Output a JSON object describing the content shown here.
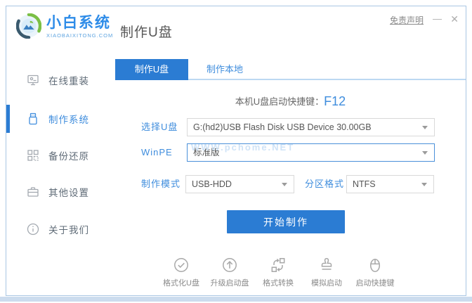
{
  "window": {
    "disclaimer": "免责声明",
    "minimize_glyph": "—",
    "close_glyph": "✕"
  },
  "header": {
    "brand": "小白系统",
    "brand_sub": "XIAOBAIXITONG.COM",
    "page_title": "制作U盘",
    "logo_icon": "swirl-globe-logo"
  },
  "sidebar": {
    "items": [
      {
        "label": "在线重装",
        "icon": "monitor-icon",
        "active": false
      },
      {
        "label": "制作系统",
        "icon": "usb-drive-icon",
        "active": true
      },
      {
        "label": "备份还原",
        "icon": "grid-icon",
        "active": false
      },
      {
        "label": "其他设置",
        "icon": "briefcase-icon",
        "active": false
      },
      {
        "label": "关于我们",
        "icon": "info-icon",
        "active": false
      }
    ]
  },
  "tabs": [
    {
      "label": "制作U盘",
      "active": true
    },
    {
      "label": "制作本地",
      "active": false
    }
  ],
  "main": {
    "hotkey_label": "本机U盘启动快捷键：",
    "hotkey_value": "F12",
    "form": {
      "usb_label": "选择U盘",
      "usb_value": "G:(hd2)USB Flash Disk USB Device 30.00GB",
      "winpe_label": "WinPE",
      "winpe_value": "标准版",
      "winpe_watermark": "WWW.pchome.NET",
      "mode_label": "制作模式",
      "mode_value": "USB-HDD",
      "partition_label": "分区格式",
      "partition_value": "NTFS"
    },
    "start_button": "开始制作"
  },
  "footer_tools": [
    {
      "label": "格式化U盘",
      "icon": "check-circle-icon"
    },
    {
      "label": "升级启动盘",
      "icon": "arrow-up-circle-icon"
    },
    {
      "label": "格式转换",
      "icon": "convert-arrows-icon"
    },
    {
      "label": "模拟启动",
      "icon": "stamp-icon"
    },
    {
      "label": "启动快捷键",
      "icon": "mouse-icon"
    }
  ],
  "colors": {
    "primary_blue": "#2b7cd3",
    "link_blue": "#3f8ddd",
    "window_border": "#a9c7e3",
    "tab_underline": "#bcd8f2",
    "watermark_blue": "#cfe3f7"
  }
}
